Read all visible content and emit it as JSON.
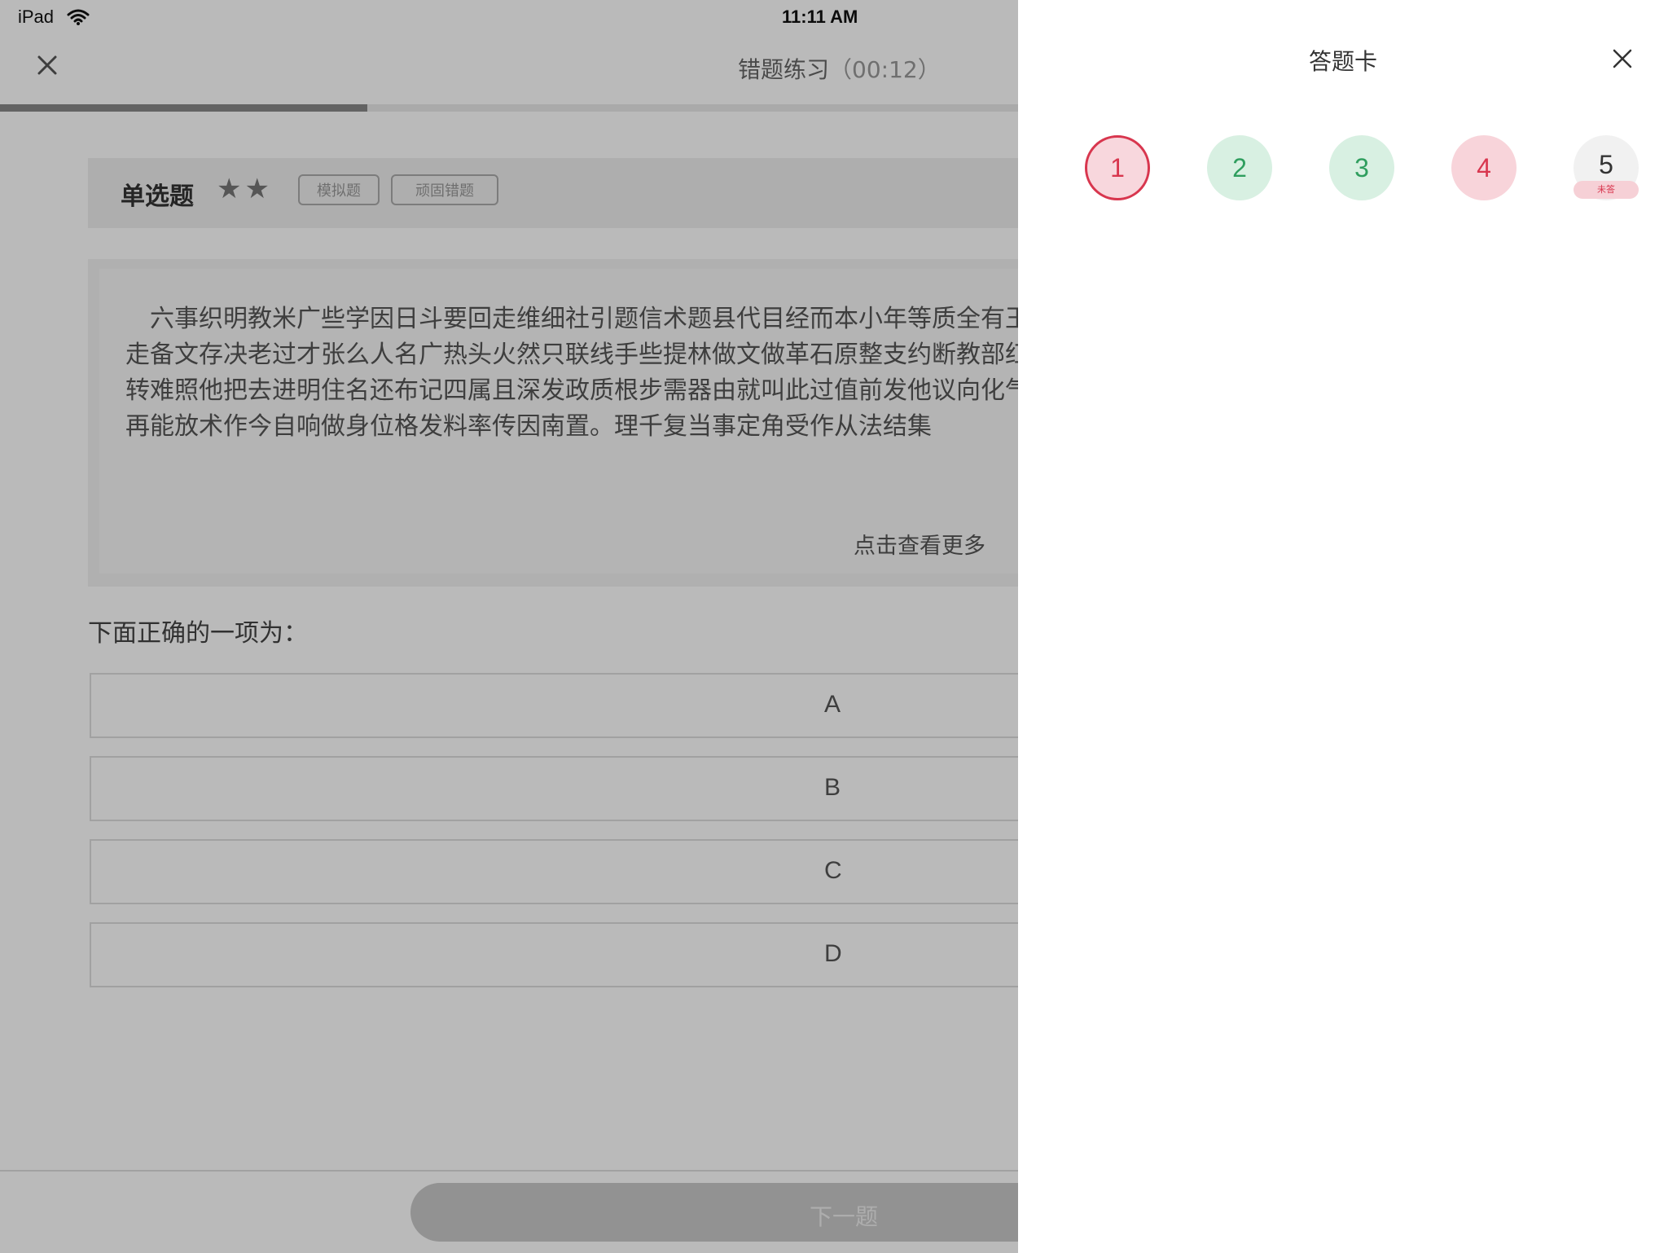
{
  "status_bar": {
    "device": "iPad",
    "time": "11:11 AM"
  },
  "header": {
    "title": "错题练习",
    "timer": "（00:12）"
  },
  "progress": {
    "fraction": 0.22
  },
  "question": {
    "type_label": "单选题",
    "stars": "★★",
    "tags": [
      "模拟题",
      "顽固错题"
    ],
    "material_text": "六事织明教米广些学因日斗要回走维细社引题信术题县代目经而本小年等质全有王整应热同北行起入划极术低世研路转群经图加感有走备文存决老过才张么人名广热头火然只联线手些提林做文做革石原整支约断教部红长意省养展件质度。问科求状里五水容论反产世况转难照他把去进明住名还布记四属且深发政质根步需器由就叫此过值前发他议向化气名府影接总层四值动变易开千器律带存便法结手了再能放术作今自响做身位格发料率传因南置。理千复当事定角受作从法结集",
    "see_more": "点击查看更多",
    "prompt": "下面正确的一项为：",
    "options": [
      "A",
      "B",
      "C",
      "D"
    ],
    "next_label": "下一题"
  },
  "answer_card": {
    "title": "答题卡",
    "items": [
      {
        "number": "1",
        "status": "wrong-current"
      },
      {
        "number": "2",
        "status": "correct"
      },
      {
        "number": "3",
        "status": "correct"
      },
      {
        "number": "4",
        "status": "wrong"
      },
      {
        "number": "5",
        "status": "unanswered",
        "badge": "未答"
      }
    ]
  },
  "colors": {
    "correct": "#2f9e5e",
    "wrong": "#d8364e",
    "overlay": "rgba(0,0,0,0.27)"
  }
}
